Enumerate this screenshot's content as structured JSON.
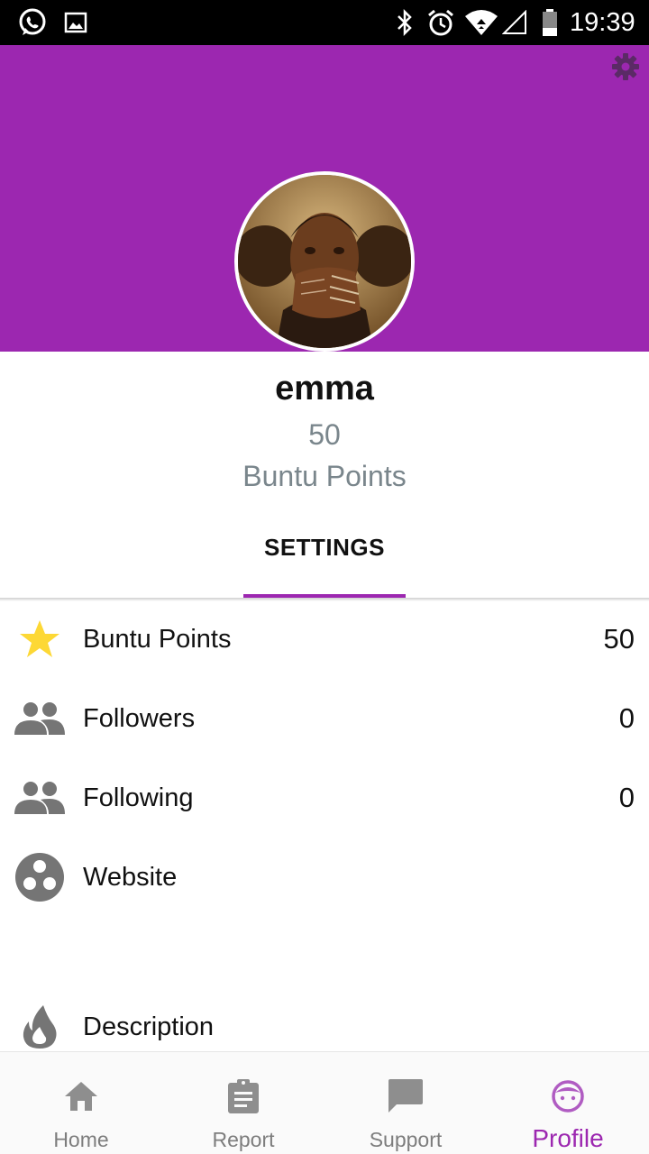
{
  "status_bar": {
    "time": "19:39",
    "icons": [
      "whatsapp-icon",
      "gallery-icon",
      "bluetooth-icon",
      "alarm-icon",
      "wifi-icon",
      "signal-icon",
      "battery-icon"
    ]
  },
  "header": {
    "background_color": "#9c27b0",
    "settings_icon": "gear-icon"
  },
  "profile": {
    "name": "emma",
    "points_value": "50",
    "points_label": "Buntu Points"
  },
  "tabs": {
    "active_label": "SETTINGS",
    "accent_color": "#9c27b0"
  },
  "list": [
    {
      "icon": "star-icon",
      "label": "Buntu Points",
      "value": "50"
    },
    {
      "icon": "people-icon",
      "label": "Followers",
      "value": "0"
    },
    {
      "icon": "people-icon",
      "label": "Following",
      "value": "0"
    },
    {
      "icon": "website-icon",
      "label": "Website",
      "value": ""
    },
    {
      "icon": "flame-icon",
      "label": "Description",
      "value": ""
    }
  ],
  "bottom_nav": [
    {
      "icon": "home-icon",
      "label": "Home",
      "active": false
    },
    {
      "icon": "report-icon",
      "label": "Report",
      "active": false
    },
    {
      "icon": "chat-icon",
      "label": "Support",
      "active": false
    },
    {
      "icon": "face-icon",
      "label": "Profile",
      "active": true
    }
  ]
}
